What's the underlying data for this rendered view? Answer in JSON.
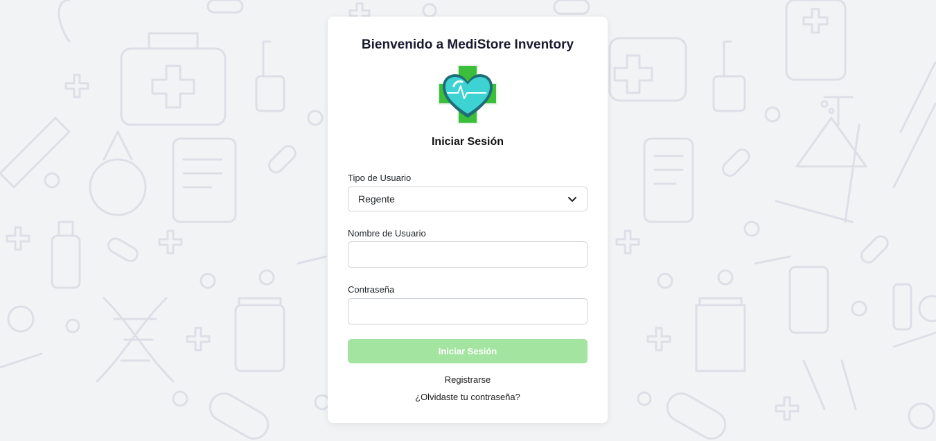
{
  "login": {
    "title": "Bienvenido a MediStore Inventory",
    "subtitle": "Iniciar Sesión",
    "user_type_label": "Tipo de Usuario",
    "user_type_value": "Regente",
    "username_label": "Nombre de Usuario",
    "username_value": "",
    "password_label": "Contraseña",
    "password_value": "",
    "submit_label": "Iniciar Sesión",
    "register_link": "Registrarse",
    "forgot_link": "¿Olvidaste tu contraseña?"
  },
  "icons": {
    "logo": "medical-cross-heart-logo",
    "select_arrow": "chevron-down-icon"
  },
  "colors": {
    "background": "#f2f3f5",
    "card": "#ffffff",
    "submit_disabled": "#a3e4a0",
    "logo_cross": "#3bbf3b",
    "logo_heart": "#3ed3d3"
  }
}
